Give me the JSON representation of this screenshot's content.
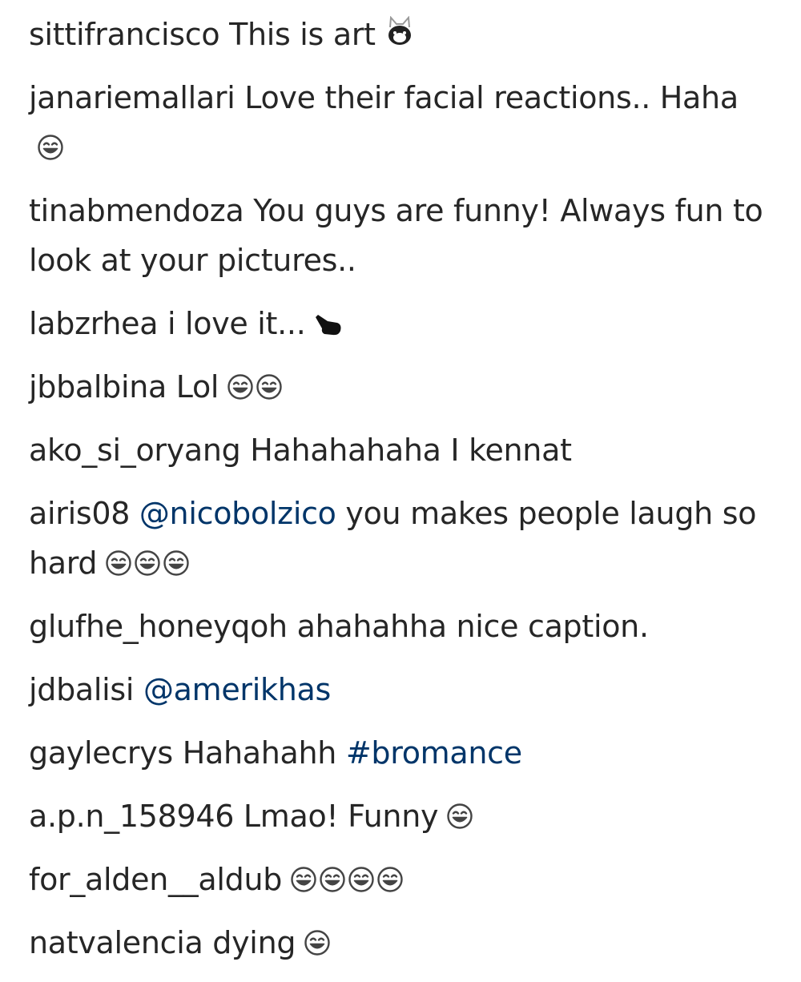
{
  "comments": [
    {
      "username": "sittifrancisco",
      "parts": [
        {
          "type": "text",
          "text": "This is art"
        }
      ],
      "emojis": [
        "crying-cat-icon"
      ]
    },
    {
      "username": "janariemallari",
      "parts": [
        {
          "type": "text",
          "text": "Love their facial reactions.. Haha"
        }
      ],
      "emojis": [
        "laughing-face-icon"
      ]
    },
    {
      "username": "tinabmendoza",
      "parts": [
        {
          "type": "text",
          "text": "You guys are funny! Always fun to look at your pictures.."
        }
      ],
      "emojis": []
    },
    {
      "username": "labzrhea",
      "parts": [
        {
          "type": "text",
          "text": "i love it..."
        }
      ],
      "emojis": [
        "pointing-hand-icon"
      ]
    },
    {
      "username": "jbbalbina",
      "parts": [
        {
          "type": "text",
          "text": "Lol"
        }
      ],
      "emojis": [
        "laughing-face-icon",
        "laughing-face-icon"
      ]
    },
    {
      "username": "ako_si_oryang",
      "parts": [
        {
          "type": "text",
          "text": "Hahahahaha I kennat"
        }
      ],
      "emojis": []
    },
    {
      "username": "airis08",
      "parts": [
        {
          "type": "mention",
          "text": "@nicobolzico"
        },
        {
          "type": "text",
          "text": "you makes people laugh so hard"
        }
      ],
      "emojis": [
        "laughing-face-icon",
        "laughing-face-icon",
        "laughing-face-icon"
      ]
    },
    {
      "username": "glufhe_honeyqoh",
      "parts": [
        {
          "type": "text",
          "text": "ahahahha nice caption."
        }
      ],
      "emojis": []
    },
    {
      "username": "jdbalisi",
      "parts": [
        {
          "type": "mention",
          "text": "@amerikhas"
        }
      ],
      "emojis": []
    },
    {
      "username": "gaylecrys",
      "parts": [
        {
          "type": "text",
          "text": "Hahahahh"
        },
        {
          "type": "hashtag",
          "text": "#bromance"
        }
      ],
      "emojis": []
    },
    {
      "username": "a.p.n_158946",
      "parts": [
        {
          "type": "text",
          "text": "Lmao! Funny"
        }
      ],
      "emojis": [
        "laughing-face-icon"
      ]
    },
    {
      "username": "for_alden__aldub",
      "parts": [],
      "emojis": [
        "laughing-face-icon",
        "laughing-face-icon",
        "laughing-face-icon",
        "laughing-face-icon"
      ]
    },
    {
      "username": "natvalencia",
      "parts": [
        {
          "type": "text",
          "text": "dying"
        }
      ],
      "emojis": [
        "laughing-face-icon"
      ]
    }
  ],
  "colors": {
    "text": "#262626",
    "link": "#003569",
    "background": "#ffffff"
  }
}
